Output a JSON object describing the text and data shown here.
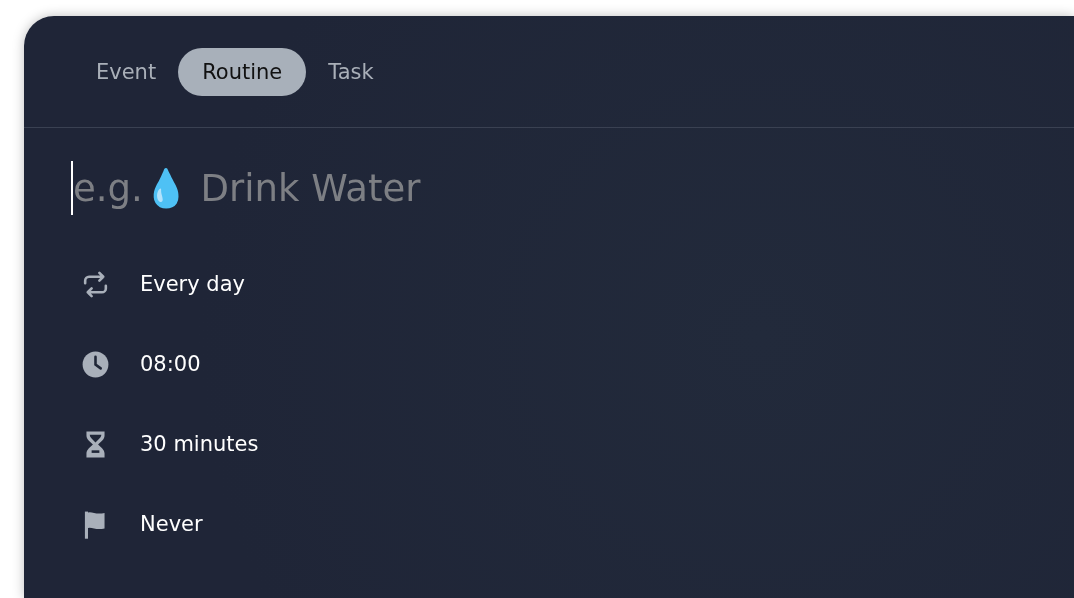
{
  "tabs": [
    {
      "label": "Event",
      "selected": false
    },
    {
      "label": "Routine",
      "selected": true
    },
    {
      "label": "Task",
      "selected": false
    }
  ],
  "title_field": {
    "placeholder": "e.g.💧 Drink Water"
  },
  "details": [
    {
      "kind": "repeat",
      "value": "Every day"
    },
    {
      "kind": "time",
      "value": "08:00"
    },
    {
      "kind": "duration",
      "value": "30 minutes"
    },
    {
      "kind": "end",
      "value": "Never"
    }
  ]
}
